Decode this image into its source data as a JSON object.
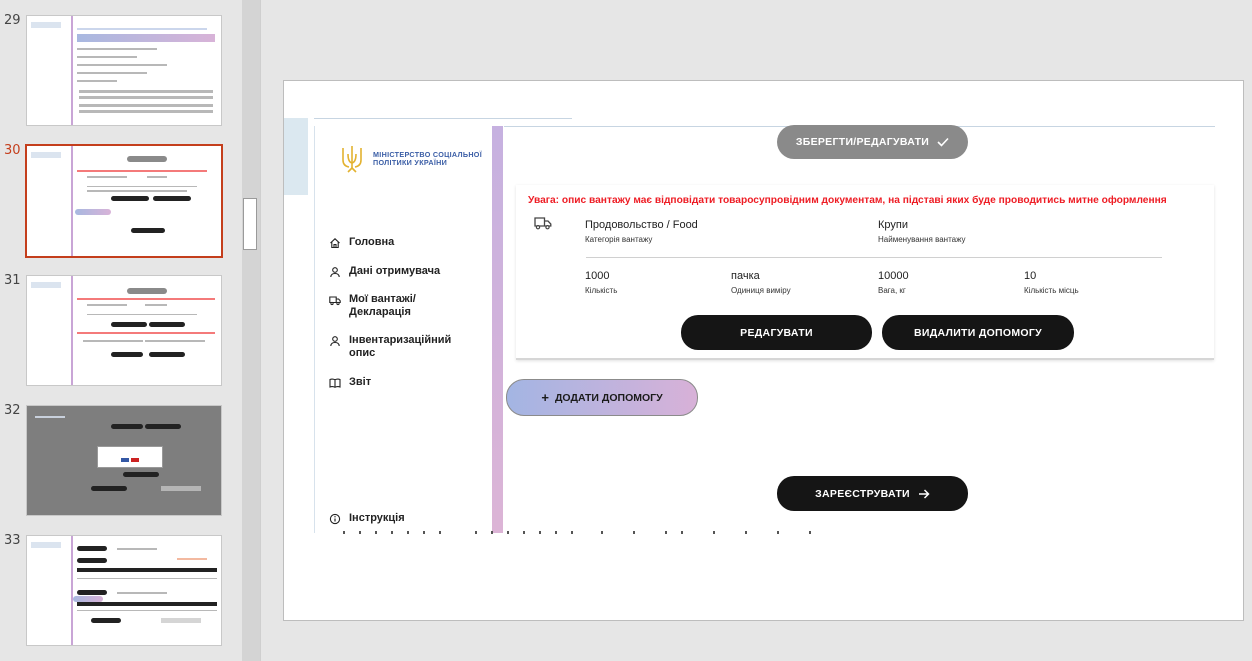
{
  "thumbnails": [
    {
      "number": "29",
      "active": false
    },
    {
      "number": "30",
      "active": true
    },
    {
      "number": "31",
      "active": false
    },
    {
      "number": "32",
      "active": false
    },
    {
      "number": "33",
      "active": false
    }
  ],
  "slide": {
    "brand": "МІНІСТЕРСТВО СОЦІАЛЬНОЇ ПОЛІТИКИ УКРАЇНИ",
    "nav": {
      "home": "Головна",
      "recipient": "Дані отримувача",
      "cargo": "Мої вантажі/ Декларація",
      "inventory": "Інвентаризаційний опис",
      "report": "Звіт",
      "instructions": "Інструкція"
    },
    "save_edit_button": "ЗБЕРЕГТИ/РЕДАГУВАТИ",
    "warning": "Увага: опис вантажу має відповідати товаросупровідним документам, на підставі яких буде проводитись митне оформлення",
    "cargo_category": {
      "value": "Продовольство / Food",
      "label": "Категорія вантажу"
    },
    "cargo_name": {
      "value": "Крупи",
      "label": "Найменування вантажу"
    },
    "quantity": {
      "value": "1000",
      "label": "Кількість"
    },
    "unit": {
      "value": "пачка",
      "label": "Одиниця виміру"
    },
    "weight": {
      "value": "10000",
      "label": "Вага, кг"
    },
    "places": {
      "value": "10",
      "label": "Кількість місць"
    },
    "edit_button": "РЕДАГУВАТИ",
    "delete_button": "ВИДАЛИТИ ДОПОМОГУ",
    "add_button": "ДОДАТИ ДОПОМОГУ",
    "register_button": "ЗАРЕЄСТРУВАТИ"
  },
  "colors": {
    "accent_red": "#c43e1c",
    "warning_red": "#ee1c24",
    "brand_blue": "#3b5ea6",
    "dark_button": "#151515",
    "gray_button": "#8a8a8a"
  }
}
